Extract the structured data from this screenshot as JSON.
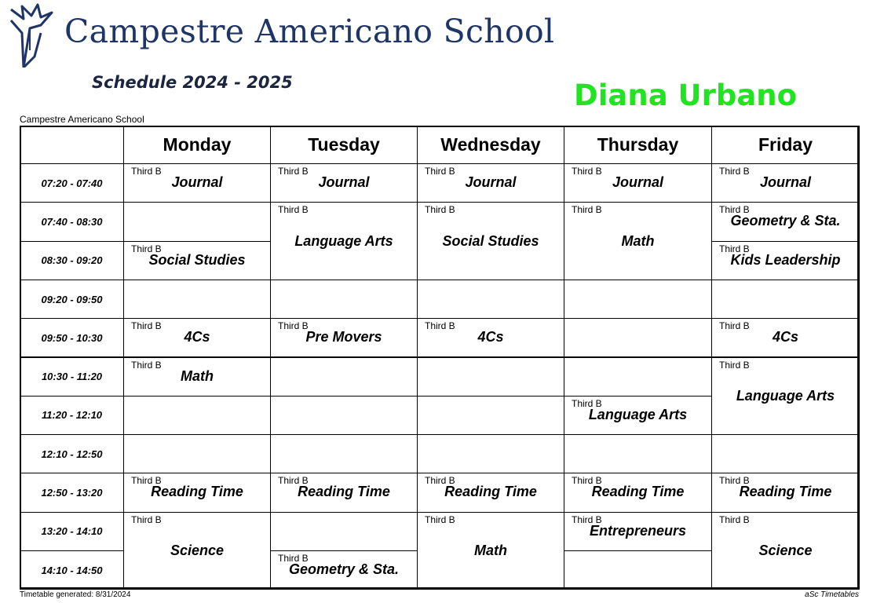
{
  "header": {
    "school_name": "Campestre Americano School",
    "schedule_title": "Schedule 2024 - 2025",
    "teacher_name": "Diana Urbano",
    "school_name_small": "Campestre Americano School"
  },
  "colors": {
    "school_title": "#1f3566",
    "teacher_name": "#22e322"
  },
  "logo_icon": "eagle-wing-logo-icon",
  "days": [
    "Monday",
    "Tuesday",
    "Wednesday",
    "Thursday",
    "Friday"
  ],
  "periods": [
    "07:20 - 07:40",
    "07:40 - 08:30",
    "08:30 - 09:20",
    "09:20 - 09:50",
    "09:50 - 10:30",
    "10:30 - 11:20",
    "11:20 - 12:10",
    "12:10 - 12:50",
    "12:50 - 13:20",
    "13:20 - 14:10",
    "14:10 - 14:50"
  ],
  "lessons": [
    {
      "day": 0,
      "start": 0,
      "span": 1,
      "class": "Third B",
      "subject": "Journal"
    },
    {
      "day": 1,
      "start": 0,
      "span": 1,
      "class": "Third B",
      "subject": "Journal"
    },
    {
      "day": 2,
      "start": 0,
      "span": 1,
      "class": "Third B",
      "subject": "Journal"
    },
    {
      "day": 3,
      "start": 0,
      "span": 1,
      "class": "Third B",
      "subject": "Journal"
    },
    {
      "day": 4,
      "start": 0,
      "span": 1,
      "class": "Third B",
      "subject": "Journal"
    },
    {
      "day": 1,
      "start": 1,
      "span": 2,
      "class": "Third B",
      "subject": "Language Arts"
    },
    {
      "day": 2,
      "start": 1,
      "span": 2,
      "class": "Third B",
      "subject": "Social Studies"
    },
    {
      "day": 3,
      "start": 1,
      "span": 2,
      "class": "Third B",
      "subject": "Math"
    },
    {
      "day": 4,
      "start": 1,
      "span": 1,
      "class": "Third B",
      "subject": "Geometry & Sta."
    },
    {
      "day": 0,
      "start": 2,
      "span": 1,
      "class": "Third B",
      "subject": "Social Studies"
    },
    {
      "day": 4,
      "start": 2,
      "span": 1,
      "class": "Third B",
      "subject": "Kids Leadership"
    },
    {
      "day": 0,
      "start": 4,
      "span": 1,
      "class": "Third B",
      "subject": "4Cs"
    },
    {
      "day": 1,
      "start": 4,
      "span": 1,
      "class": "Third B",
      "subject": "Pre Movers"
    },
    {
      "day": 2,
      "start": 4,
      "span": 1,
      "class": "Third B",
      "subject": "4Cs"
    },
    {
      "day": 4,
      "start": 4,
      "span": 1,
      "class": "Third B",
      "subject": "4Cs"
    },
    {
      "day": 0,
      "start": 5,
      "span": 1,
      "class": "Third B",
      "subject": "Math"
    },
    {
      "day": 4,
      "start": 5,
      "span": 2,
      "class": "Third B",
      "subject": "Language Arts"
    },
    {
      "day": 3,
      "start": 6,
      "span": 1,
      "class": "Third B",
      "subject": "Language Arts"
    },
    {
      "day": 0,
      "start": 8,
      "span": 1,
      "class": "Third B",
      "subject": "Reading Time"
    },
    {
      "day": 1,
      "start": 8,
      "span": 1,
      "class": "Third B",
      "subject": "Reading Time"
    },
    {
      "day": 2,
      "start": 8,
      "span": 1,
      "class": "Third B",
      "subject": "Reading Time"
    },
    {
      "day": 3,
      "start": 8,
      "span": 1,
      "class": "Third B",
      "subject": "Reading Time"
    },
    {
      "day": 4,
      "start": 8,
      "span": 1,
      "class": "Third B",
      "subject": "Reading Time"
    },
    {
      "day": 0,
      "start": 9,
      "span": 2,
      "class": "Third B",
      "subject": "Science"
    },
    {
      "day": 2,
      "start": 9,
      "span": 2,
      "class": "Third B",
      "subject": "Math"
    },
    {
      "day": 3,
      "start": 9,
      "span": 1,
      "class": "Third B",
      "subject": "Entrepreneurs"
    },
    {
      "day": 4,
      "start": 9,
      "span": 2,
      "class": "Third B",
      "subject": "Science"
    },
    {
      "day": 1,
      "start": 10,
      "span": 1,
      "class": "Third B",
      "subject": "Geometry & Sta."
    }
  ],
  "footer": {
    "generated": "Timetable generated: 8/31/2024",
    "brand": "aSc Timetables"
  }
}
